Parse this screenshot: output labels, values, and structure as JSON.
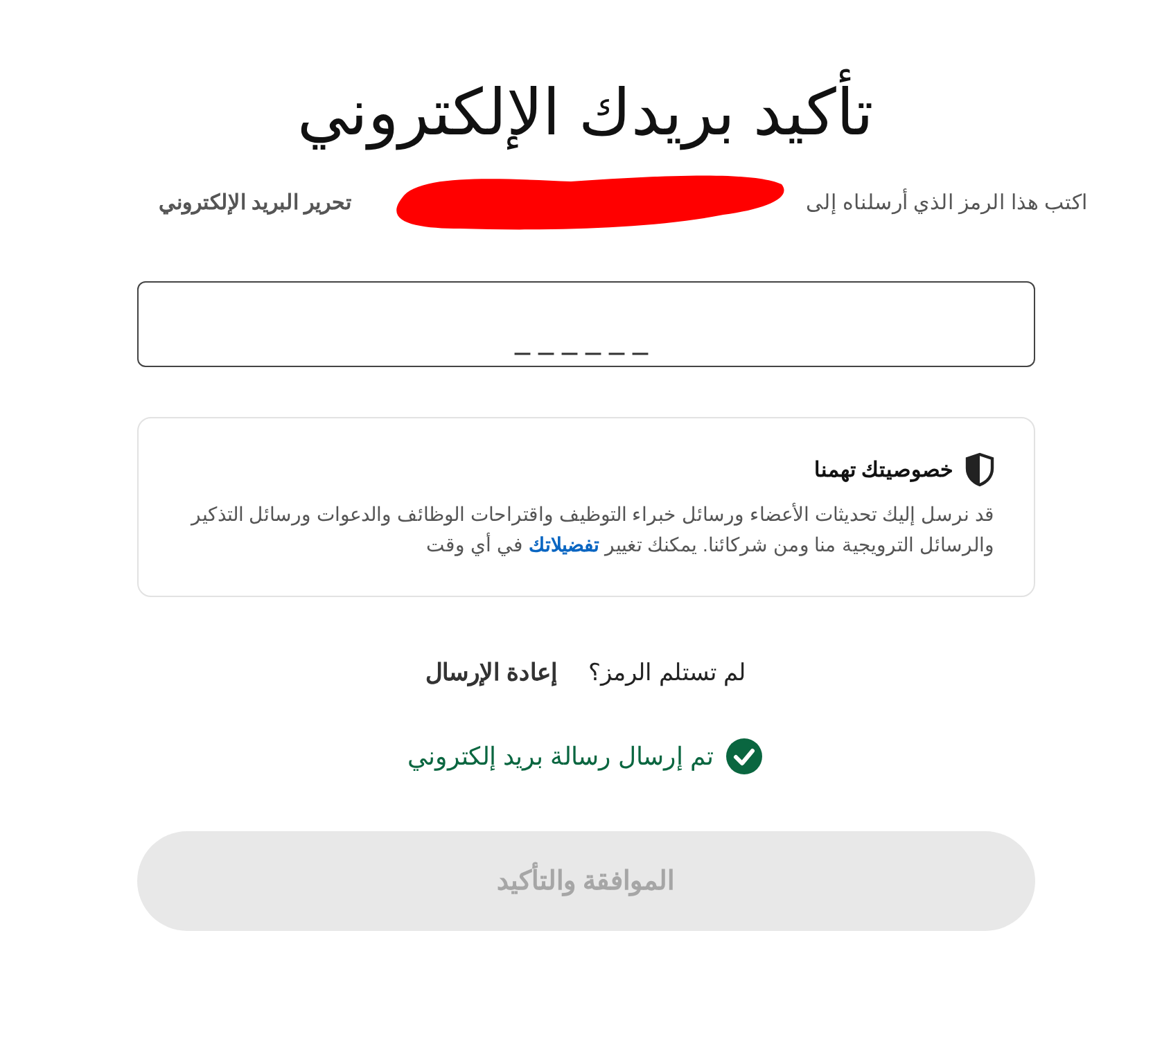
{
  "title": "تأكيد بريدك الإلكتروني",
  "instruction": {
    "text": "اكتب هذا الرمز الذي أرسلناه إلى",
    "edit_link": "تحرير البريد الإلكتروني"
  },
  "code_field": {
    "placeholder": "______"
  },
  "privacy": {
    "heading": "خصوصيتك تهمنا",
    "text_before": "قد نرسل إليك تحديثات الأعضاء ورسائل خبراء التوظيف واقتراحات الوظائف والدعوات ورسائل التذكير والرسائل الترويجية منا ومن شركائنا. يمكنك تغيير",
    "link": "تفضيلاتك",
    "text_after": "في أي وقت"
  },
  "resend": {
    "question": "لم تستلم الرمز؟",
    "link": "إعادة الإرسال"
  },
  "status": {
    "text": "تم إرسال رسالة بريد إلكتروني"
  },
  "submit": {
    "label": "الموافقة والتأكيد",
    "disabled": true
  }
}
